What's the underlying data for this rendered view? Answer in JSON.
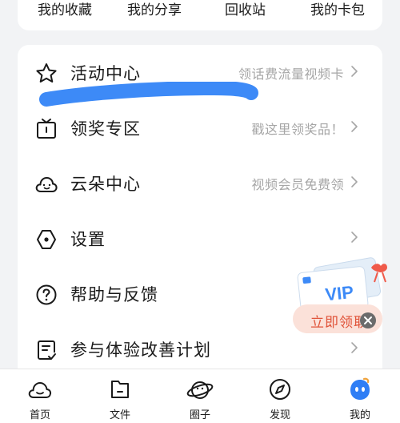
{
  "quick_links": [
    {
      "label": "我的收藏"
    },
    {
      "label": "我的分享"
    },
    {
      "label": "回收站"
    },
    {
      "label": "我的卡包"
    }
  ],
  "menu": [
    {
      "label": "活动中心",
      "hint": "领话费流量视频卡",
      "icon": "star-icon"
    },
    {
      "label": "领奖专区",
      "hint": "戳这里领奖品！",
      "icon": "tv-icon"
    },
    {
      "label": "云朵中心",
      "hint": "视频会员免费领",
      "icon": "cloud-icon"
    },
    {
      "label": "设置",
      "hint": "",
      "icon": "settings-icon"
    },
    {
      "label": "帮助与反馈",
      "hint": "",
      "icon": "help-icon"
    },
    {
      "label": "参与体验改善计划",
      "hint": "",
      "icon": "clipboard-icon"
    }
  ],
  "vip_promo": {
    "badge": "VIP",
    "button_label": "立即领取"
  },
  "tabs": [
    {
      "label": "首页",
      "icon": "home-cloud-icon"
    },
    {
      "label": "文件",
      "icon": "folder-icon"
    },
    {
      "label": "圈子",
      "icon": "planet-icon"
    },
    {
      "label": "发现",
      "icon": "compass-icon"
    },
    {
      "label": "我的",
      "icon": "profile-avatar-icon",
      "active": true
    }
  ],
  "colors": {
    "accent_blue": "#3d8af7",
    "vip_orange": "#e0543a",
    "hint_gray": "#a6a6a6"
  }
}
